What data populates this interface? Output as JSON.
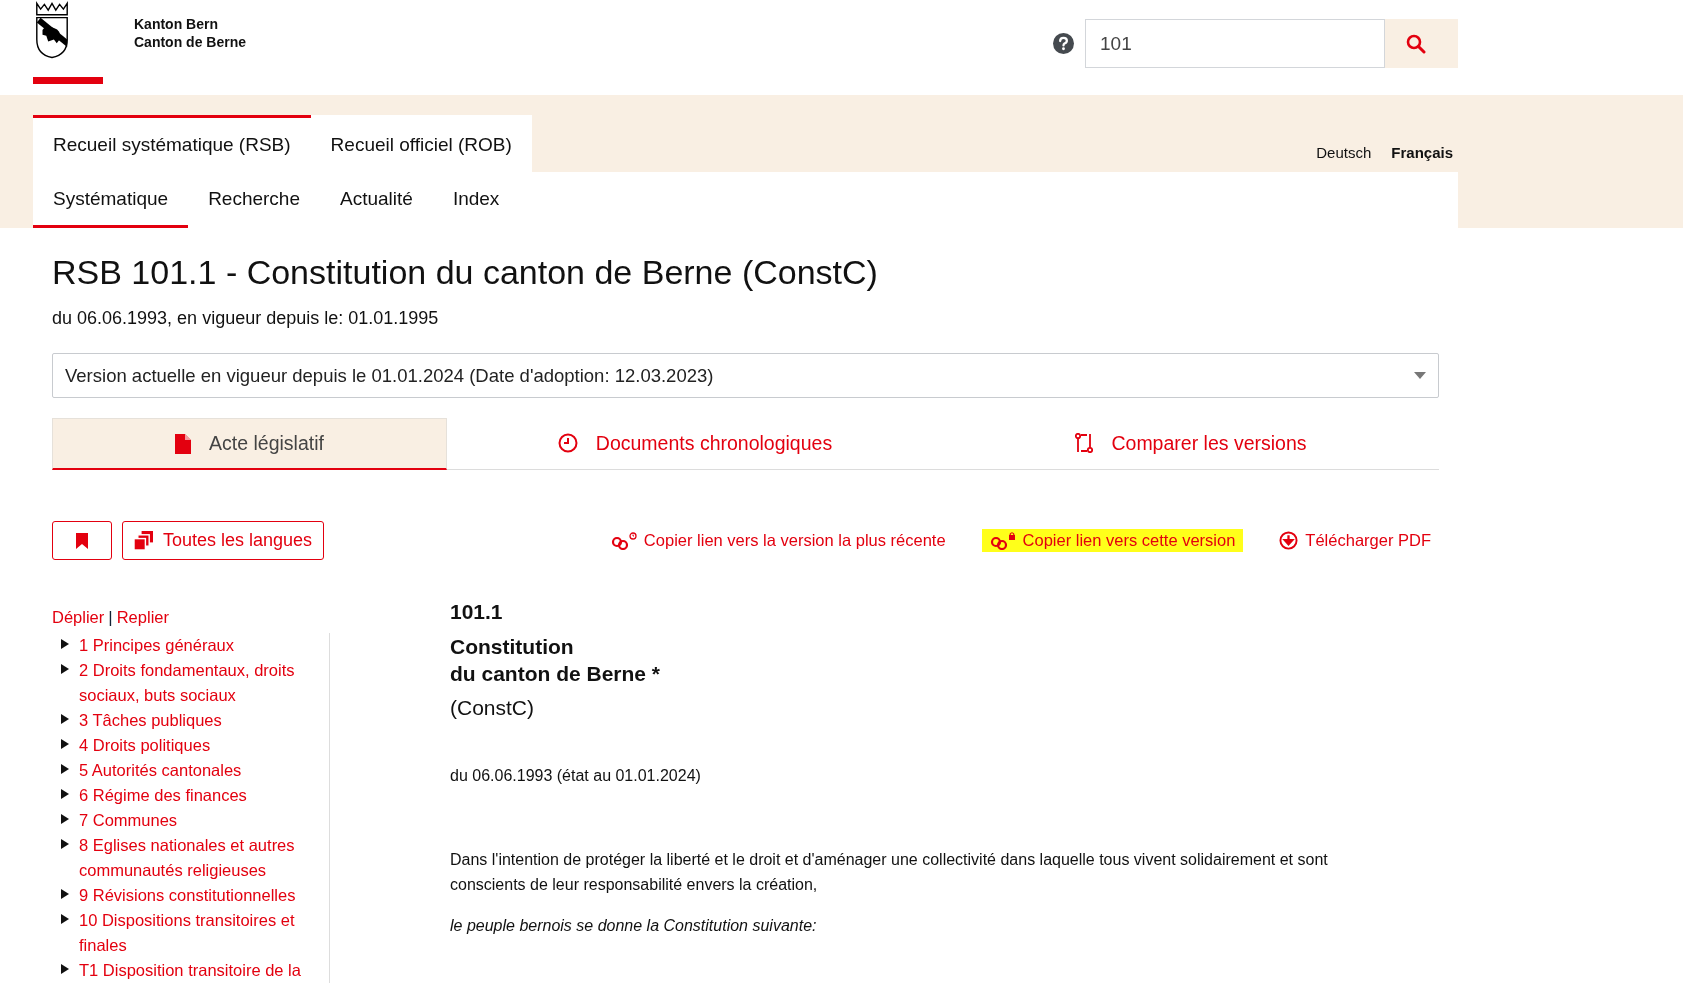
{
  "header": {
    "brand_lines": [
      "Kanton Bern",
      "Canton de Berne"
    ],
    "search": {
      "value": "101"
    }
  },
  "top_tabs": [
    {
      "label": "Recueil systématique (RSB)",
      "selected": true
    },
    {
      "label": "Recueil officiel (ROB)",
      "selected": false
    }
  ],
  "languages": [
    {
      "label": "Deutsch",
      "selected": false
    },
    {
      "label": "Français",
      "selected": true
    }
  ],
  "nav": [
    {
      "label": "Systématique",
      "selected": true
    },
    {
      "label": "Recherche",
      "selected": false
    },
    {
      "label": "Actualité",
      "selected": false
    },
    {
      "label": "Index",
      "selected": false
    }
  ],
  "law": {
    "title": "RSB 101.1 - Constitution du canton de Berne (ConstC)",
    "subtitle": "du 06.06.1993, en vigueur depuis le: 01.01.1995",
    "version_select": "Version actuelle en vigueur depuis le 01.01.2024 (Date d'adoption: 12.03.2023)"
  },
  "view_tabs": [
    {
      "label": "Acte législatif",
      "kind": "document",
      "selected": true
    },
    {
      "label": "Documents chronologiques",
      "kind": "clock",
      "selected": false
    },
    {
      "label": "Comparer les versions",
      "kind": "compare",
      "selected": false
    }
  ],
  "toolbar": {
    "all_languages": "Toutes les langues",
    "links": [
      {
        "label": "Copier lien vers la version la plus récente",
        "kind": "link-latest",
        "highlighted": false
      },
      {
        "label": "Copier lien vers cette version",
        "kind": "link-version",
        "highlighted": true
      },
      {
        "label": "Télécharger PDF",
        "kind": "download",
        "highlighted": false
      }
    ]
  },
  "sidebar": {
    "expand": "Déplier",
    "separator": "|",
    "collapse": "Replier",
    "items": [
      {
        "label": "1 Principes généraux",
        "expanded": false
      },
      {
        "label": "2 Droits fondamentaux, droits sociaux, buts sociaux",
        "expanded": false
      },
      {
        "label": "3 Tâches publiques",
        "expanded": false
      },
      {
        "label": "4 Droits politiques",
        "expanded": false
      },
      {
        "label": "5 Autorités cantonales",
        "expanded": false
      },
      {
        "label": "6 Régime des finances",
        "expanded": false
      },
      {
        "label": "7 Communes",
        "expanded": false
      },
      {
        "label": "8 Eglises nationales et autres communautés religieuses",
        "expanded": false
      },
      {
        "label": "9 Révisions constitutionnelles",
        "expanded": false
      },
      {
        "label": "10 Dispositions transitoires et finales",
        "expanded": false
      },
      {
        "label": "T1 Disposition transitoire de la",
        "expanded": false
      }
    ]
  },
  "document": {
    "number": "101.1",
    "title_lines": [
      "Constitution",
      "du canton de Berne *"
    ],
    "abbreviation": "(ConstC)",
    "date": "du 06.06.1993 (état au 01.01.2024)",
    "preamble": "Dans l'intention de protéger la liberté et le droit et d'aménager une collectivité dans laquelle tous vivent solidairement et sont conscients de leur responsabilité envers la création,",
    "closing": "le peuple bernois se donne la Constitution suivante:"
  }
}
